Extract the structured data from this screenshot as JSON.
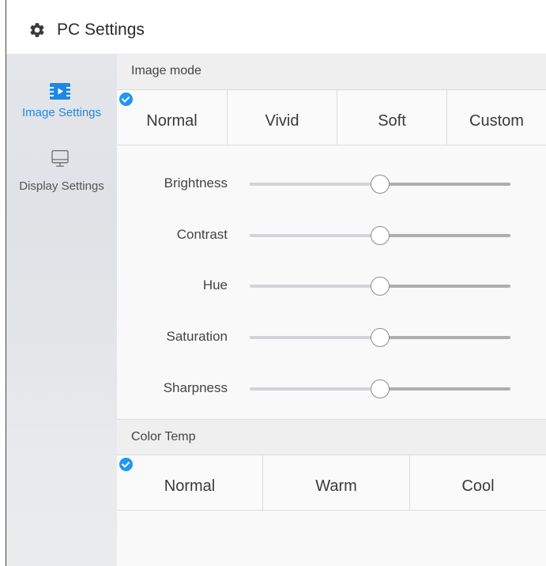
{
  "header": {
    "title": "PC Settings",
    "icon": "gear-icon"
  },
  "sidebar": {
    "items": [
      {
        "label": "Image Settings",
        "icon": "image-settings-icon",
        "active": true
      },
      {
        "label": "Display Settings",
        "icon": "monitor-icon",
        "active": false
      }
    ]
  },
  "image_mode": {
    "title": "Image mode",
    "options": [
      "Normal",
      "Vivid",
      "Soft",
      "Custom"
    ],
    "selected": "Normal"
  },
  "sliders": [
    {
      "label": "Brightness",
      "value": 0.5
    },
    {
      "label": "Contrast",
      "value": 0.5
    },
    {
      "label": "Hue",
      "value": 0.5
    },
    {
      "label": "Saturation",
      "value": 0.5
    },
    {
      "label": "Sharpness",
      "value": 0.5
    }
  ],
  "color_temp": {
    "title": "Color Temp",
    "options": [
      "Normal",
      "Warm",
      "Cool"
    ],
    "selected": "Normal"
  },
  "colors": {
    "accent": "#1e88e5",
    "check": "#2196f3"
  }
}
